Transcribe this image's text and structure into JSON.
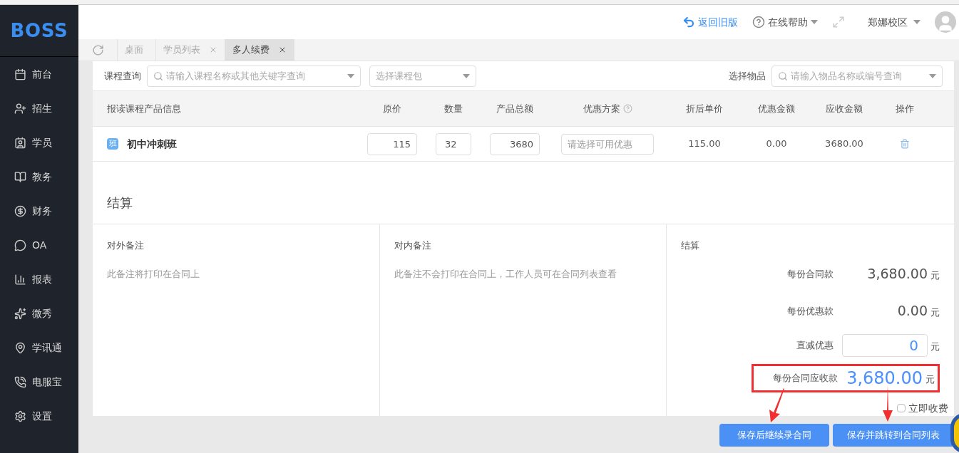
{
  "logo": "BOSS",
  "sidebar": {
    "items": [
      {
        "label": "前台"
      },
      {
        "label": "招生"
      },
      {
        "label": "学员"
      },
      {
        "label": "教务"
      },
      {
        "label": "财务"
      },
      {
        "label": "OA"
      },
      {
        "label": "报表"
      },
      {
        "label": "微秀"
      },
      {
        "label": "学讯通"
      },
      {
        "label": "电服宝"
      },
      {
        "label": "设置"
      }
    ]
  },
  "header": {
    "back_link": "返回旧版",
    "help": "在线帮助",
    "campus": "郑娜校区"
  },
  "tabs": [
    {
      "label": "桌面",
      "selected": false,
      "closable": false
    },
    {
      "label": "学员列表",
      "selected": false,
      "closable": true
    },
    {
      "label": "多人续费",
      "selected": true,
      "closable": true
    }
  ],
  "query": {
    "course_label": "课程查询",
    "course_placeholder": "请输入课程名称或其他关键字查询",
    "package_placeholder": "选择课程包",
    "goods_label": "选择物品",
    "goods_placeholder": "请输入物品名称或编号查询"
  },
  "table": {
    "columns": [
      "报读课程产品信息",
      "原价",
      "数量",
      "产品总额",
      "优惠方案",
      "折后单价",
      "优惠金额",
      "应收金额",
      "操作"
    ],
    "rows": [
      {
        "badge": "班",
        "name": "初中冲刺班",
        "price": "115",
        "quantity": "32",
        "total": "3680",
        "discount_placeholder": "请选择可用优惠",
        "unit_price": "115.00",
        "discount_amount": "0.00",
        "receivable": "3680.00"
      }
    ]
  },
  "settlement": {
    "title": "结算",
    "external_note": {
      "label": "对外备注",
      "placeholder": "此备注将打印在合同上"
    },
    "internal_note": {
      "label": "对内备注",
      "placeholder": "此备注不会打印在合同上，工作人员可在合同列表查看"
    },
    "summary": {
      "title": "结算",
      "lines": [
        {
          "kind": "text",
          "label": "每份合同款",
          "value": "3,680.00",
          "unit": "元"
        },
        {
          "kind": "text",
          "label": "每份优惠款",
          "value": "0.00",
          "unit": "元"
        },
        {
          "kind": "input",
          "label": "直减优惠",
          "value": "0",
          "unit": "元"
        },
        {
          "kind": "total",
          "label": "每份合同应收款",
          "value": "3,680.00",
          "unit": "元"
        }
      ],
      "collect_now": {
        "label": "立即收费",
        "checked": false
      }
    }
  },
  "buttons": [
    "保存后继续录合同",
    "保存并跳转到合同列表"
  ]
}
